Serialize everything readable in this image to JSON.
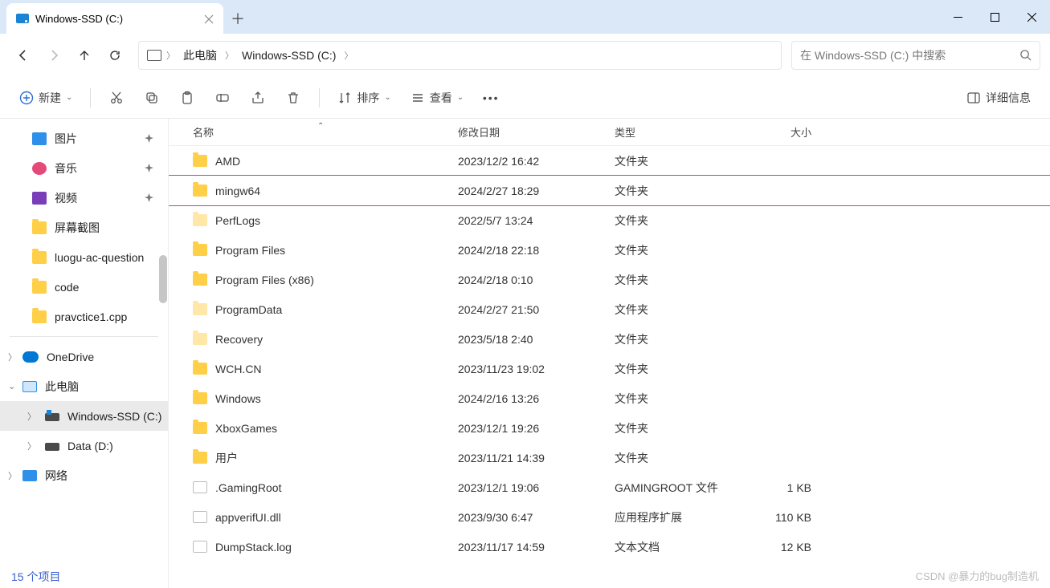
{
  "tab": {
    "title": "Windows-SSD (C:)"
  },
  "breadcrumb": {
    "pc": "此电脑",
    "drive": "Windows-SSD (C:)"
  },
  "search": {
    "placeholder": "在 Windows-SSD (C:) 中搜索"
  },
  "toolbar": {
    "new": "新建",
    "sort": "排序",
    "view": "查看",
    "details": "详细信息"
  },
  "columns": {
    "name": "名称",
    "date": "修改日期",
    "type": "类型",
    "size": "大小"
  },
  "sidebar": {
    "quick": [
      {
        "label": "图片",
        "icon": "pic",
        "pinned": true
      },
      {
        "label": "音乐",
        "icon": "music",
        "pinned": true
      },
      {
        "label": "视频",
        "icon": "video",
        "pinned": true
      },
      {
        "label": "屏幕截图",
        "icon": "folder",
        "pinned": false
      },
      {
        "label": "luogu-ac-question",
        "icon": "folder",
        "pinned": false
      },
      {
        "label": "code",
        "icon": "folder",
        "pinned": false
      },
      {
        "label": "pravctice1.cpp",
        "icon": "folder",
        "pinned": false
      }
    ],
    "onedrive": "OneDrive",
    "thispc": "此电脑",
    "drives": [
      {
        "label": "Windows-SSD (C:)",
        "selected": true,
        "win": true
      },
      {
        "label": "Data (D:)",
        "selected": false,
        "win": false
      }
    ],
    "network": "网络"
  },
  "files": [
    {
      "name": "AMD",
      "date": "2023/12/2 16:42",
      "type": "文件夹",
      "size": "",
      "icon": "folder"
    },
    {
      "name": "mingw64",
      "date": "2024/2/27 18:29",
      "type": "文件夹",
      "size": "",
      "icon": "folder",
      "highlight": true
    },
    {
      "name": "PerfLogs",
      "date": "2022/5/7 13:24",
      "type": "文件夹",
      "size": "",
      "icon": "folder-faded"
    },
    {
      "name": "Program Files",
      "date": "2024/2/18 22:18",
      "type": "文件夹",
      "size": "",
      "icon": "folder"
    },
    {
      "name": "Program Files (x86)",
      "date": "2024/2/18 0:10",
      "type": "文件夹",
      "size": "",
      "icon": "folder"
    },
    {
      "name": "ProgramData",
      "date": "2024/2/27 21:50",
      "type": "文件夹",
      "size": "",
      "icon": "folder-faded"
    },
    {
      "name": "Recovery",
      "date": "2023/5/18 2:40",
      "type": "文件夹",
      "size": "",
      "icon": "folder-faded"
    },
    {
      "name": "WCH.CN",
      "date": "2023/11/23 19:02",
      "type": "文件夹",
      "size": "",
      "icon": "folder"
    },
    {
      "name": "Windows",
      "date": "2024/2/16 13:26",
      "type": "文件夹",
      "size": "",
      "icon": "folder"
    },
    {
      "name": "XboxGames",
      "date": "2023/12/1 19:26",
      "type": "文件夹",
      "size": "",
      "icon": "folder"
    },
    {
      "name": "用户",
      "date": "2023/11/21 14:39",
      "type": "文件夹",
      "size": "",
      "icon": "folder"
    },
    {
      "name": ".GamingRoot",
      "date": "2023/12/1 19:06",
      "type": "GAMINGROOT 文件",
      "size": "1 KB",
      "icon": "file"
    },
    {
      "name": "appverifUI.dll",
      "date": "2023/9/30 6:47",
      "type": "应用程序扩展",
      "size": "110 KB",
      "icon": "file"
    },
    {
      "name": "DumpStack.log",
      "date": "2023/11/17 14:59",
      "type": "文本文档",
      "size": "12 KB",
      "icon": "file"
    }
  ],
  "footer": {
    "count": "15 个项目"
  },
  "watermark": "CSDN @暴力的bug制造机"
}
